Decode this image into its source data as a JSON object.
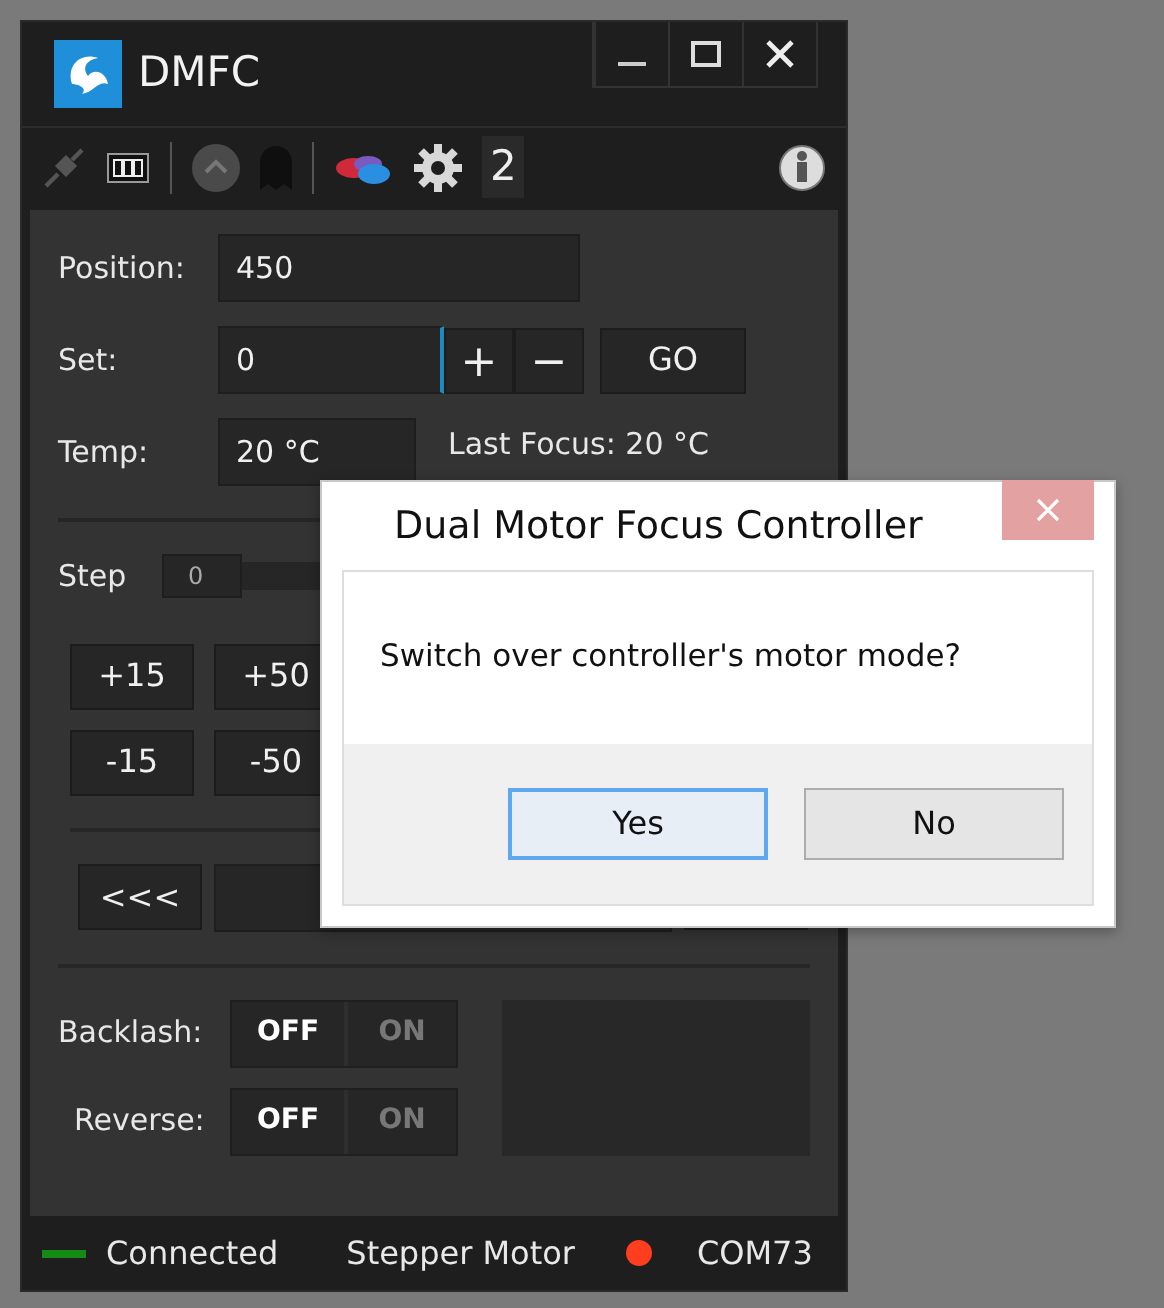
{
  "window": {
    "title": "DMFC"
  },
  "toolbar": {
    "profile": "2"
  },
  "position": {
    "label": "Position:",
    "value": "450"
  },
  "set": {
    "label": "Set:",
    "value": "0",
    "plus": "+",
    "minus": "−",
    "go": "GO"
  },
  "temp": {
    "label": "Temp:",
    "value": "20 °C",
    "last_focus": "Last Focus: 20 °C"
  },
  "step": {
    "label": "Step",
    "value": "0"
  },
  "step_buttons": [
    [
      "+15",
      "+50"
    ],
    [
      "-15",
      "-50"
    ]
  ],
  "nav_button": "<<<",
  "toggles": [
    {
      "label": "Backlash:",
      "options": [
        {
          "text": "OFF",
          "selected": true
        },
        {
          "text": "ON",
          "selected": false
        }
      ]
    },
    {
      "label": "Reverse:",
      "options": [
        {
          "text": "OFF",
          "selected": true
        },
        {
          "text": "ON",
          "selected": false
        }
      ]
    }
  ],
  "status_bar": [
    {
      "kind": "line",
      "text": "Connected",
      "color": "#158a15"
    },
    {
      "kind": "plain",
      "text": "Stepper Motor"
    },
    {
      "kind": "dot",
      "text": "COM73",
      "color": "#ff3d1f"
    }
  ],
  "dialog": {
    "title": "Dual Motor Focus Controller",
    "message": "Switch over controller's motor mode?",
    "buttons": [
      {
        "label": "Yes",
        "default": true
      },
      {
        "label": "No",
        "default": false
      }
    ]
  }
}
